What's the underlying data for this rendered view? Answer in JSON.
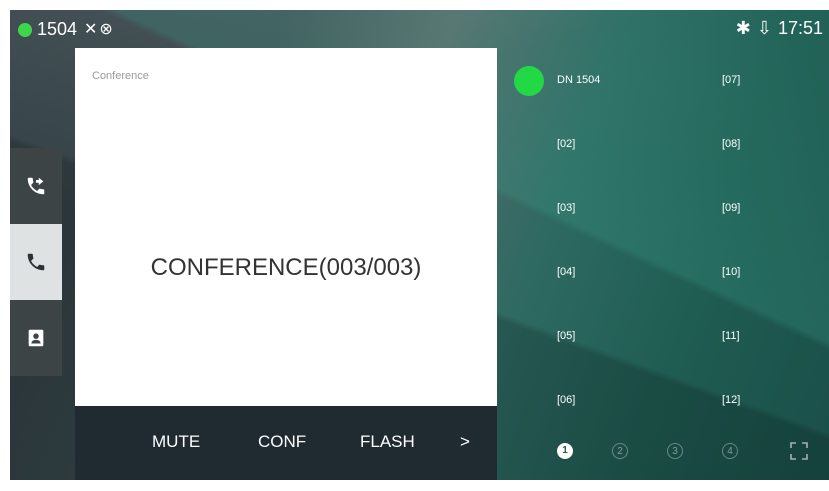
{
  "status_bar": {
    "ext_number": "1504",
    "status_glyphs": "✕⊗",
    "bluetooth_glyph": "✱",
    "usb_glyph": "⇩",
    "time": "17:51"
  },
  "nav": {
    "items": [
      {
        "icon": "call-forward-icon",
        "active": false
      },
      {
        "icon": "phone-icon",
        "active": true
      },
      {
        "icon": "contacts-icon",
        "active": false
      }
    ]
  },
  "card": {
    "title": "Conference",
    "status_text": "CONFERENCE(003/003)"
  },
  "softkeys": {
    "mute": "MUTE",
    "conf": "CONF",
    "flash": "FLASH",
    "more": ">"
  },
  "line_keys": {
    "left": [
      "DN 1504",
      "[02]",
      "[03]",
      "[04]",
      "[05]",
      "[06]"
    ],
    "right": [
      "[07]",
      "[08]",
      "[09]",
      "[10]",
      "[11]",
      "[12]"
    ]
  },
  "pager": {
    "pages": [
      "1",
      "2",
      "3",
      "4"
    ],
    "active_index": 0
  },
  "colors": {
    "registered_green": "#22d845",
    "softkey_bar": "#1f2a31",
    "card_bg": "#ffffff"
  }
}
